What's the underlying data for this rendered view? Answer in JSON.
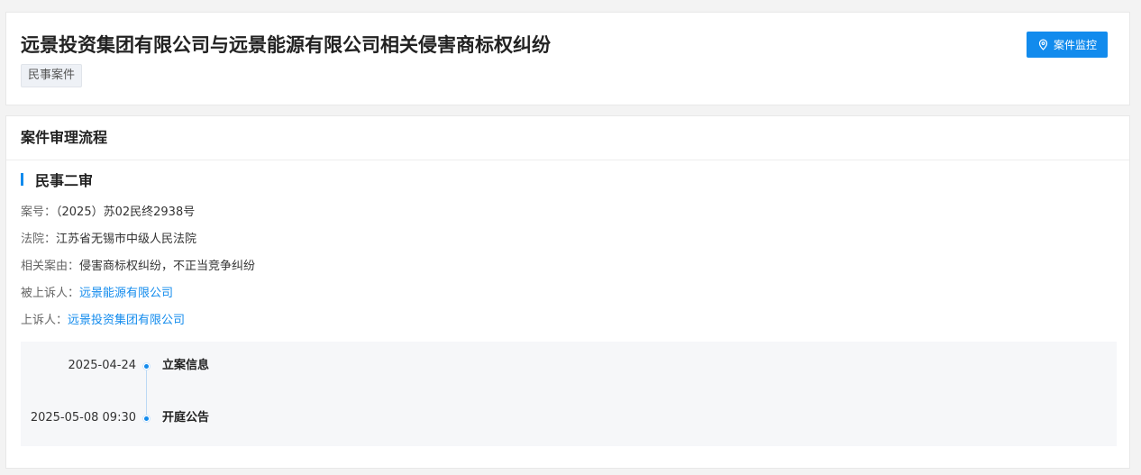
{
  "header": {
    "title": "远景投资集团有限公司与远景能源有限公司相关侵害商标权纠纷",
    "tag": "民事案件",
    "monitor_button": "案件监控",
    "monitor_icon": "location-pin-icon"
  },
  "process": {
    "section_title": "案件审理流程",
    "stage_title": "民事二审",
    "fields": {
      "case_no_label": "案号：",
      "case_no": "（2025）苏02民终2938号",
      "court_label": "法院：",
      "court": "江苏省无锡市中级人民法院",
      "cause_label": "相关案由：",
      "cause": "侵害商标权纠纷，不正当竞争纠纷",
      "appellee_label": "被上诉人：",
      "appellee": "远景能源有限公司",
      "appellant_label": "上诉人：",
      "appellant": "远景投资集团有限公司"
    },
    "timeline": [
      {
        "date": "2025-04-24",
        "label": "立案信息"
      },
      {
        "date": "2025-05-08 09:30",
        "label": "开庭公告"
      }
    ]
  },
  "colors": {
    "accent": "#128bed",
    "page_bg": "#f3f3f3"
  }
}
